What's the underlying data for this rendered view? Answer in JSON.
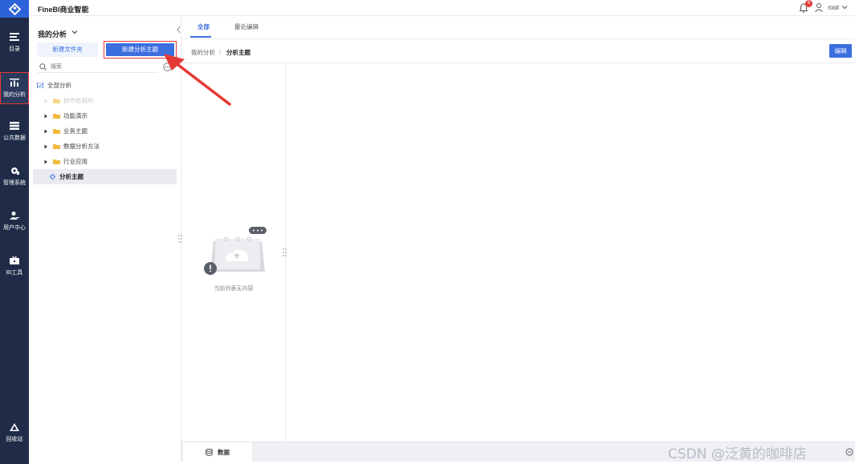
{
  "app": {
    "title": "FineBI商业智能"
  },
  "header": {
    "notification_count": "6",
    "user_name": "root"
  },
  "nav": {
    "items": [
      {
        "label": "目录",
        "icon": "catalog-icon"
      },
      {
        "label": "我的分析",
        "icon": "my-analysis-icon",
        "active": true
      },
      {
        "label": "公共数据",
        "icon": "public-data-icon"
      },
      {
        "label": "管理系统",
        "icon": "admin-gear-icon"
      },
      {
        "label": "用户中心",
        "icon": "user-center-icon"
      },
      {
        "label": "BI工具",
        "icon": "toolbox-icon"
      }
    ],
    "recycle_label": "回收站"
  },
  "panel": {
    "title": "我的分析",
    "new_folder_label": "新建文件夹",
    "new_theme_label": "新建分析主题",
    "search_placeholder": "搜索",
    "tree": [
      {
        "label": "全部分析",
        "type": "root"
      },
      {
        "label": "协作给我的",
        "type": "folder",
        "dim": true
      },
      {
        "label": "功能演示",
        "type": "folder"
      },
      {
        "label": "业务主题",
        "type": "folder"
      },
      {
        "label": "数据分析方法",
        "type": "folder"
      },
      {
        "label": "行业应用",
        "type": "folder"
      },
      {
        "label": "分析主题",
        "type": "theme",
        "selected": true
      }
    ]
  },
  "main": {
    "tabs": [
      {
        "label": "全部",
        "active": true
      },
      {
        "label": "最近编辑"
      }
    ],
    "breadcrumb": {
      "root": "我的分析",
      "separator": "/",
      "current": "分析主题"
    },
    "edit_label": "编辑",
    "empty_text": "当前列表无内容",
    "bottom_tab_label": "数据"
  },
  "watermark": "CSDN @泛黄的咖啡店",
  "colors": {
    "accent": "#3c6ee0",
    "nav_bg": "#1f2b47",
    "highlight": "#e53935"
  }
}
